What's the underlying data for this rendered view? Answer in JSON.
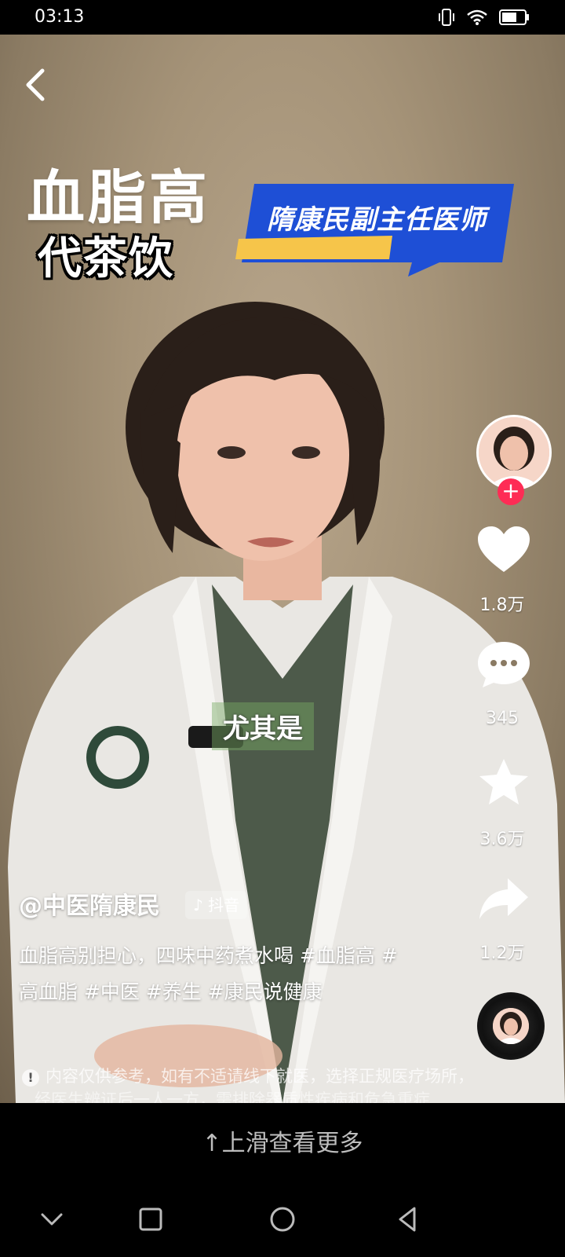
{
  "status_bar": {
    "time": "03:13"
  },
  "overlay": {
    "headline": "血脂高",
    "sub_headline": "代茶饮",
    "doctor_title": "隋康民副主任医师",
    "subtitle": "尤其是"
  },
  "actions": {
    "likes": "1.8万",
    "comments": "345",
    "favorites": "3.6万",
    "shares": "1.2万"
  },
  "post": {
    "author": "@中医隋康民",
    "platform_tag": "抖音",
    "caption": "血脂高别担心，四味中药煮水喝 #血脂高 #高血脂 #中医 #养生 #康民说健康",
    "disclaimer_line1": "内容仅供参考，如有不适请线下就医，选择正规医疗场所，",
    "disclaimer_line2": "经医生辨证后一人一方，需排除器质性疾病和危急重症"
  },
  "more_prompt": "上滑查看更多",
  "colors": {
    "follow": "#fe2c55",
    "banner_blue": "#1e4fd6",
    "banner_yellow": "#f6c54a"
  }
}
